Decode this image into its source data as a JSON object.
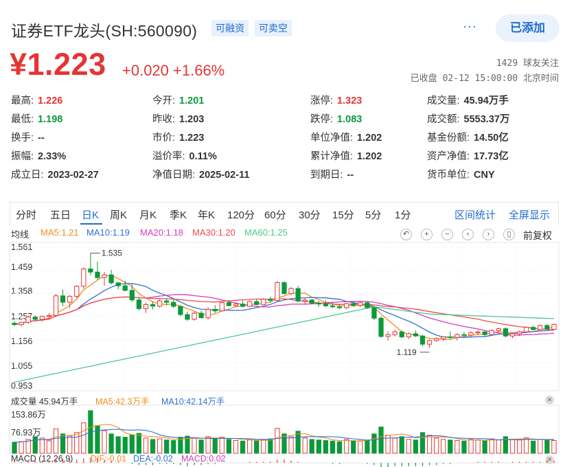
{
  "header": {
    "title": "证券ETF龙头(SH:560090)",
    "tags": [
      "可融资",
      "可卖空"
    ],
    "more": "···",
    "add_label": "已添加",
    "price": "¥1.223",
    "change": "+0.020 +1.66%",
    "followers": "1429 球友关注",
    "status": "已收盘 02-12 15:00:00 北京时间"
  },
  "stats": [
    {
      "label": "最高:",
      "value": "1.226",
      "color": "red"
    },
    {
      "label": "今开:",
      "value": "1.201",
      "color": "grn"
    },
    {
      "label": "涨停:",
      "value": "1.323",
      "color": "red"
    },
    {
      "label": "成交量:",
      "value": "45.94万手",
      "color": ""
    },
    {
      "label": "最低:",
      "value": "1.198",
      "color": "grn"
    },
    {
      "label": "昨收:",
      "value": "1.203",
      "color": ""
    },
    {
      "label": "跌停:",
      "value": "1.083",
      "color": "grn"
    },
    {
      "label": "成交额:",
      "value": "5553.37万",
      "color": ""
    },
    {
      "label": "换手:",
      "value": "--",
      "color": ""
    },
    {
      "label": "市价:",
      "value": "1.223",
      "color": ""
    },
    {
      "label": "单位净值:",
      "value": "1.202",
      "color": ""
    },
    {
      "label": "基金份额:",
      "value": "14.50亿",
      "color": ""
    },
    {
      "label": "振幅:",
      "value": "2.33%",
      "color": ""
    },
    {
      "label": "溢价率:",
      "value": "0.11%",
      "color": ""
    },
    {
      "label": "累计净值:",
      "value": "1.202",
      "color": ""
    },
    {
      "label": "资产净值:",
      "value": "17.73亿",
      "color": ""
    },
    {
      "label": "成立日:",
      "value": "2023-02-27",
      "color": ""
    },
    {
      "label": "净值日期:",
      "value": "2025-02-11",
      "color": ""
    },
    {
      "label": "到期日:",
      "value": "--",
      "color": ""
    },
    {
      "label": "货币单位:",
      "value": "CNY",
      "color": ""
    }
  ],
  "tabs": [
    "分时",
    "五日",
    "日K",
    "周K",
    "月K",
    "季K",
    "年K",
    "120分",
    "60分",
    "30分",
    "15分",
    "5分",
    "1分"
  ],
  "active_tab": "日K",
  "tab_right": [
    "区间统计",
    "全屏显示"
  ],
  "chart_legend": {
    "label": "均线",
    "items": [
      {
        "text": "MA5:1.21",
        "color": "#f28c1e"
      },
      {
        "text": "MA10:1.19",
        "color": "#2f6fd6"
      },
      {
        "text": "MA20:1.18",
        "color": "#d63ac0"
      },
      {
        "text": "MA30:1.20",
        "color": "#ef4b4b"
      },
      {
        "text": "MA60:1.25",
        "color": "#4cc78a"
      }
    ],
    "adjust": "前复权"
  },
  "toolbar_icons": [
    "undo-icon",
    "zoom-in-icon",
    "zoom-out-icon",
    "prev-icon",
    "next-icon",
    "candle-style-icon"
  ],
  "volume_legend": {
    "label": "成交量 45.94万手",
    "items": [
      {
        "text": "MA5:42.3万手",
        "color": "#f28c1e"
      },
      {
        "text": "MA10:42.14万手",
        "color": "#2f6fd6"
      }
    ]
  },
  "macd_legend": {
    "label": "MACD (12,26,9)",
    "items": [
      {
        "text": "DIF:-0.01",
        "color": "#f28c1e"
      },
      {
        "text": "DEA:-0.02",
        "color": "#2f6fd6"
      },
      {
        "text": "MACD:0.02",
        "color": "#d63ac0"
      }
    ]
  },
  "colors": {
    "up": "#e63434",
    "down": "#0a9a3a",
    "accent": "#1f6bd1"
  },
  "chart_data": {
    "type": "candlestick",
    "y_axis_ticks": [
      "1.561",
      "1.459",
      "1.358",
      "1.257",
      "1.156",
      "1.055",
      "0.953"
    ],
    "ylim": [
      0.953,
      1.561
    ],
    "annotations": [
      {
        "text": "1.535",
        "type": "high"
      },
      {
        "text": "1.119",
        "type": "low"
      }
    ],
    "candles": [
      [
        1.228,
        1.236,
        1.216,
        1.222
      ],
      [
        1.222,
        1.234,
        1.214,
        1.232
      ],
      [
        1.232,
        1.262,
        1.225,
        1.255
      ],
      [
        1.255,
        1.262,
        1.238,
        1.245
      ],
      [
        1.245,
        1.262,
        1.236,
        1.258
      ],
      [
        1.258,
        1.272,
        1.247,
        1.262
      ],
      [
        1.262,
        1.356,
        1.255,
        1.348
      ],
      [
        1.348,
        1.376,
        1.302,
        1.32
      ],
      [
        1.32,
        1.352,
        1.294,
        1.346
      ],
      [
        1.346,
        1.395,
        1.338,
        1.39
      ],
      [
        1.39,
        1.472,
        1.379,
        1.466
      ],
      [
        1.466,
        1.535,
        1.438,
        1.452
      ],
      [
        1.452,
        1.498,
        1.418,
        1.428
      ],
      [
        1.428,
        1.452,
        1.393,
        1.44
      ],
      [
        1.44,
        1.462,
        1.398,
        1.405
      ],
      [
        1.405,
        1.408,
        1.377,
        1.392
      ],
      [
        1.392,
        1.414,
        1.368,
        1.372
      ],
      [
        1.372,
        1.398,
        1.322,
        1.33
      ],
      [
        1.33,
        1.342,
        1.283,
        1.292
      ],
      [
        1.292,
        1.318,
        1.273,
        1.31
      ],
      [
        1.31,
        1.323,
        1.288,
        1.303
      ],
      [
        1.303,
        1.333,
        1.296,
        1.326
      ],
      [
        1.326,
        1.338,
        1.306,
        1.32
      ],
      [
        1.32,
        1.332,
        1.295,
        1.302
      ],
      [
        1.302,
        1.306,
        1.258,
        1.266
      ],
      [
        1.266,
        1.279,
        1.238,
        1.245
      ],
      [
        1.245,
        1.278,
        1.239,
        1.272
      ],
      [
        1.272,
        1.283,
        1.249,
        1.252
      ],
      [
        1.252,
        1.298,
        1.244,
        1.289
      ],
      [
        1.289,
        1.308,
        1.272,
        1.282
      ],
      [
        1.282,
        1.32,
        1.278,
        1.318
      ],
      [
        1.318,
        1.326,
        1.302,
        1.305
      ],
      [
        1.305,
        1.318,
        1.298,
        1.312
      ],
      [
        1.312,
        1.326,
        1.296,
        1.302
      ],
      [
        1.302,
        1.328,
        1.298,
        1.323
      ],
      [
        1.323,
        1.332,
        1.306,
        1.31
      ],
      [
        1.31,
        1.338,
        1.308,
        1.333
      ],
      [
        1.333,
        1.345,
        1.318,
        1.328
      ],
      [
        1.328,
        1.412,
        1.324,
        1.406
      ],
      [
        1.406,
        1.412,
        1.352,
        1.358
      ],
      [
        1.358,
        1.386,
        1.35,
        1.38
      ],
      [
        1.38,
        1.392,
        1.319,
        1.325
      ],
      [
        1.325,
        1.338,
        1.31,
        1.33
      ],
      [
        1.33,
        1.334,
        1.312,
        1.316
      ],
      [
        1.316,
        1.326,
        1.3,
        1.312
      ],
      [
        1.312,
        1.33,
        1.298,
        1.304
      ],
      [
        1.304,
        1.32,
        1.294,
        1.3
      ],
      [
        1.3,
        1.312,
        1.29,
        1.296
      ],
      [
        1.296,
        1.318,
        1.29,
        1.314
      ],
      [
        1.314,
        1.322,
        1.3,
        1.306
      ],
      [
        1.306,
        1.322,
        1.298,
        1.318
      ],
      [
        1.318,
        1.322,
        1.292,
        1.296
      ],
      [
        1.296,
        1.3,
        1.242,
        1.25
      ],
      [
        1.25,
        1.258,
        1.164,
        1.17
      ],
      [
        1.17,
        1.192,
        1.152,
        1.178
      ],
      [
        1.178,
        1.2,
        1.17,
        1.19
      ],
      [
        1.19,
        1.196,
        1.162,
        1.168
      ],
      [
        1.168,
        1.188,
        1.16,
        1.182
      ],
      [
        1.182,
        1.196,
        1.168,
        1.172
      ],
      [
        1.172,
        1.176,
        1.128,
        1.136
      ],
      [
        1.136,
        1.158,
        1.119,
        1.152
      ],
      [
        1.152,
        1.166,
        1.146,
        1.16
      ],
      [
        1.16,
        1.172,
        1.15,
        1.168
      ],
      [
        1.168,
        1.192,
        1.158,
        1.166
      ],
      [
        1.166,
        1.184,
        1.152,
        1.178
      ],
      [
        1.178,
        1.19,
        1.168,
        1.176
      ],
      [
        1.176,
        1.192,
        1.17,
        1.186
      ],
      [
        1.186,
        1.198,
        1.176,
        1.19
      ],
      [
        1.19,
        1.194,
        1.172,
        1.178
      ],
      [
        1.178,
        1.202,
        1.176,
        1.196
      ],
      [
        1.196,
        1.208,
        1.188,
        1.204
      ],
      [
        1.204,
        1.21,
        1.166,
        1.172
      ],
      [
        1.172,
        1.186,
        1.162,
        1.182
      ],
      [
        1.182,
        1.196,
        1.172,
        1.19
      ],
      [
        1.19,
        1.215,
        1.186,
        1.21
      ],
      [
        1.21,
        1.218,
        1.196,
        1.2
      ],
      [
        1.2,
        1.222,
        1.196,
        1.218
      ],
      [
        1.218,
        1.224,
        1.2,
        1.203
      ],
      [
        1.201,
        1.226,
        1.198,
        1.223
      ]
    ],
    "volume": [
      40,
      42,
      50,
      60,
      55,
      45,
      88,
      70,
      62,
      75,
      110,
      154,
      100,
      82,
      70,
      60,
      58,
      66,
      72,
      55,
      50,
      52,
      48,
      46,
      58,
      62,
      55,
      48,
      60,
      52,
      58,
      50,
      46,
      44,
      48,
      45,
      50,
      52,
      90,
      70,
      60,
      80,
      55,
      50,
      48,
      46,
      44,
      42,
      50,
      46,
      44,
      48,
      70,
      95,
      65,
      55,
      60,
      50,
      48,
      75,
      65,
      55,
      50,
      48,
      46,
      44,
      50,
      48,
      46,
      52,
      48,
      60,
      50,
      48,
      56,
      44,
      50,
      46,
      46
    ],
    "macd": [
      0.01,
      0.01,
      0.02,
      0.02,
      0.02,
      0.02,
      0.03,
      0.03,
      0.03,
      0.03,
      0.04,
      0.05,
      0.04,
      0.03,
      0.02,
      0.01,
      0.0,
      -0.01,
      -0.02,
      -0.02,
      -0.02,
      -0.01,
      -0.01,
      -0.01,
      -0.02,
      -0.03,
      -0.02,
      -0.02,
      -0.01,
      -0.01,
      0.0,
      0.0,
      0.0,
      0.0,
      0.01,
      0.01,
      0.01,
      0.01,
      0.03,
      0.03,
      0.02,
      0.01,
      0.0,
      0.0,
      0.0,
      0.0,
      -0.01,
      -0.01,
      0.0,
      0.0,
      0.0,
      -0.01,
      -0.02,
      -0.04,
      -0.04,
      -0.03,
      -0.03,
      -0.03,
      -0.03,
      -0.03,
      -0.02,
      -0.02,
      -0.01,
      -0.01,
      0.0,
      0.0,
      0.0,
      0.01,
      0.01,
      0.01,
      0.01,
      0.0,
      0.01,
      0.01,
      0.01,
      0.01,
      0.01,
      0.02,
      0.02
    ]
  }
}
